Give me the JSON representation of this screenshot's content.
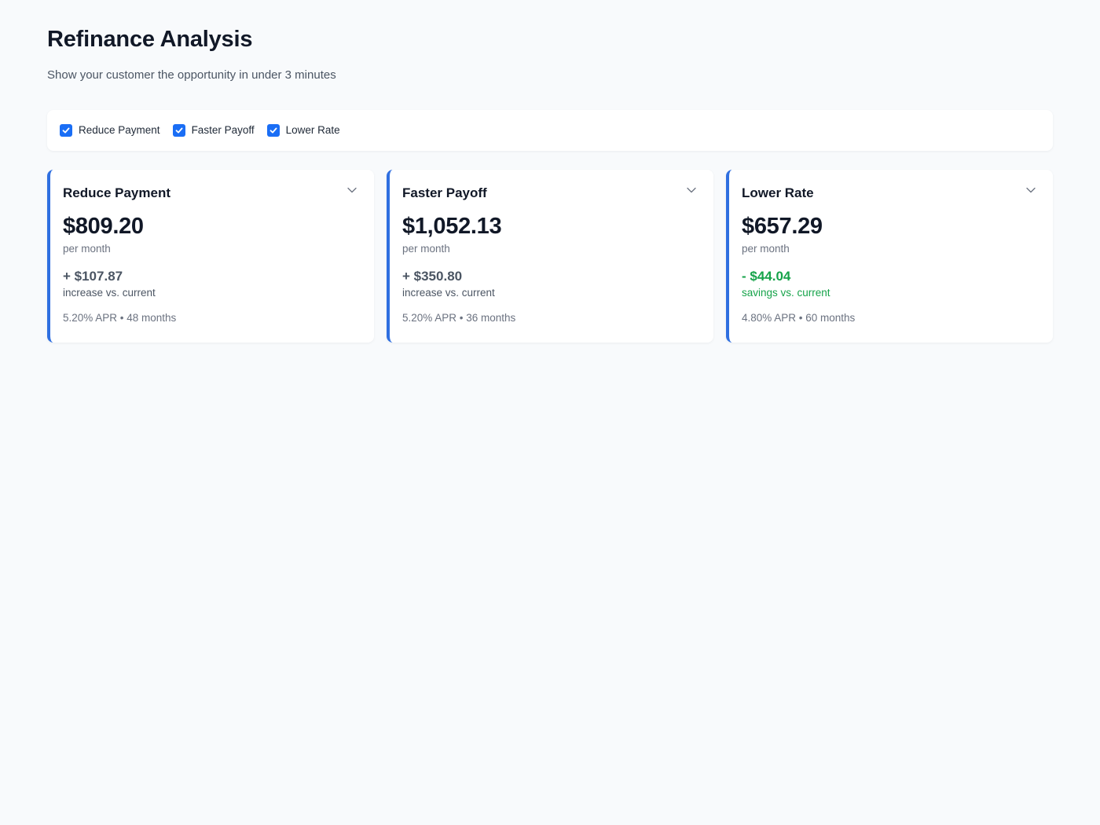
{
  "header": {
    "title": "Refinance Analysis",
    "subtitle": "Show your customer the opportunity in under 3 minutes"
  },
  "filters": [
    {
      "label": "Reduce Payment",
      "checked": true
    },
    {
      "label": "Faster Payoff",
      "checked": true
    },
    {
      "label": "Lower Rate",
      "checked": true
    }
  ],
  "cards": [
    {
      "title": "Reduce Payment",
      "amount": "$809.20",
      "period": "per month",
      "delta": "+ $107.87",
      "delta_note": "increase vs. current",
      "terms": "5.20% APR • 48 months"
    },
    {
      "title": "Faster Payoff",
      "amount": "$1,052.13",
      "period": "per month",
      "delta": "+ $350.80",
      "delta_note": "increase vs. current",
      "terms": "5.20% APR • 36 months"
    },
    {
      "title": "Lower Rate",
      "amount": "$657.29",
      "period": "per month",
      "delta": "- $44.04",
      "delta_note": "savings vs. current",
      "terms": "4.80% APR • 60 months"
    }
  ],
  "icons": {
    "checkbox": "checkmark-icon",
    "expand": "chevron-down-icon"
  },
  "colors": {
    "accent": "#2f6fe0",
    "checkbox": "#1a6ef5",
    "savings": "#16a34a",
    "background": "#f8fafc"
  }
}
